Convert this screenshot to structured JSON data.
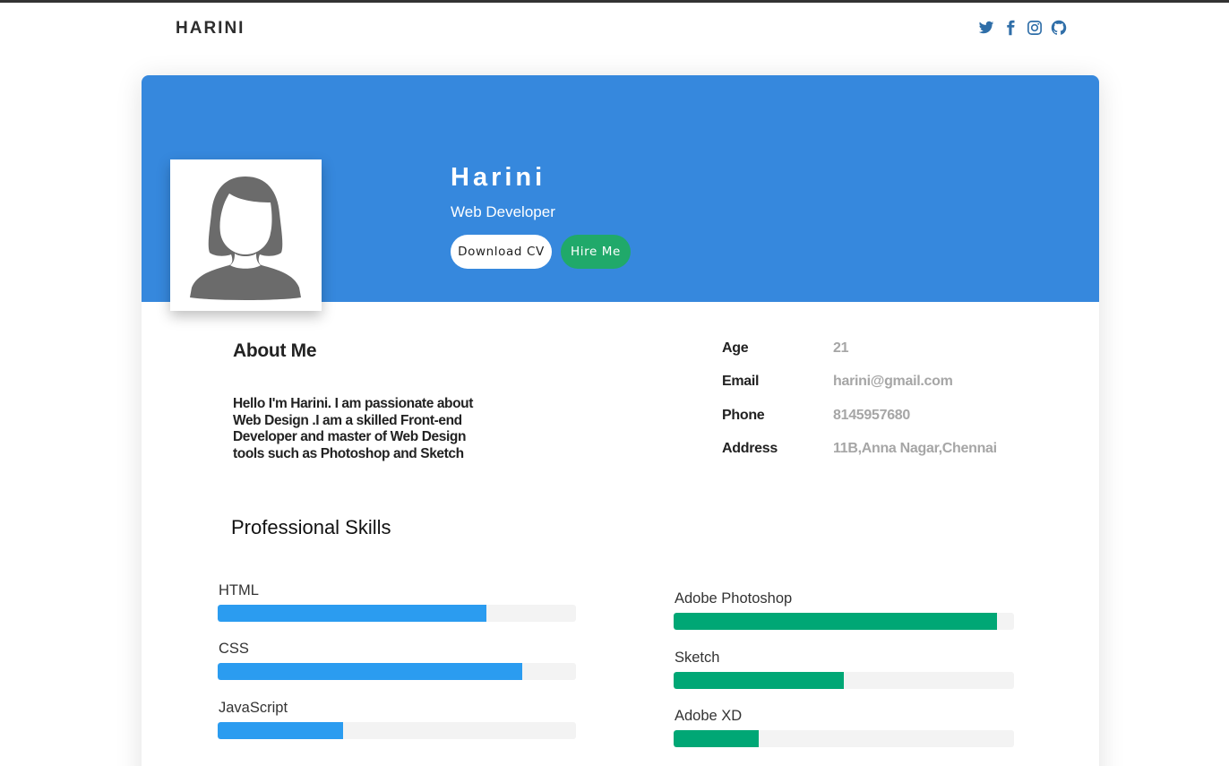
{
  "header": {
    "brand": "HARINI",
    "social_icons": [
      "twitter-icon",
      "facebook-icon",
      "instagram-icon",
      "github-icon"
    ],
    "icon_color": "#2f6ea8"
  },
  "profile": {
    "name": "Harini",
    "role": "Web Developer",
    "download_label": "Download CV",
    "hire_label": "Hire Me",
    "header_color": "#3688dd",
    "hire_color": "#20a96a"
  },
  "about": {
    "title": "About Me",
    "text": "Hello I'm Harini. I am passionate about Web Design .I am a skilled Front-end Developer and master of Web Design tools such as Photoshop and Sketch"
  },
  "info": [
    {
      "label": "Age",
      "value": "21"
    },
    {
      "label": "Email",
      "value": "harini@gmail.com"
    },
    {
      "label": "Phone",
      "value": "8145957680"
    },
    {
      "label": "Address",
      "value": "11B,Anna Nagar,Chennai"
    }
  ],
  "skills": {
    "title": "Professional Skills",
    "left": [
      {
        "label": "HTML",
        "percent": 75
      },
      {
        "label": "CSS",
        "percent": 85
      },
      {
        "label": "JavaScript",
        "percent": 35
      }
    ],
    "right": [
      {
        "label": "Adobe Photoshop",
        "percent": 95
      },
      {
        "label": "Sketch",
        "percent": 50
      },
      {
        "label": "Adobe XD",
        "percent": 25
      }
    ],
    "left_color": "#2b9cf0",
    "right_color": "#00a775"
  }
}
